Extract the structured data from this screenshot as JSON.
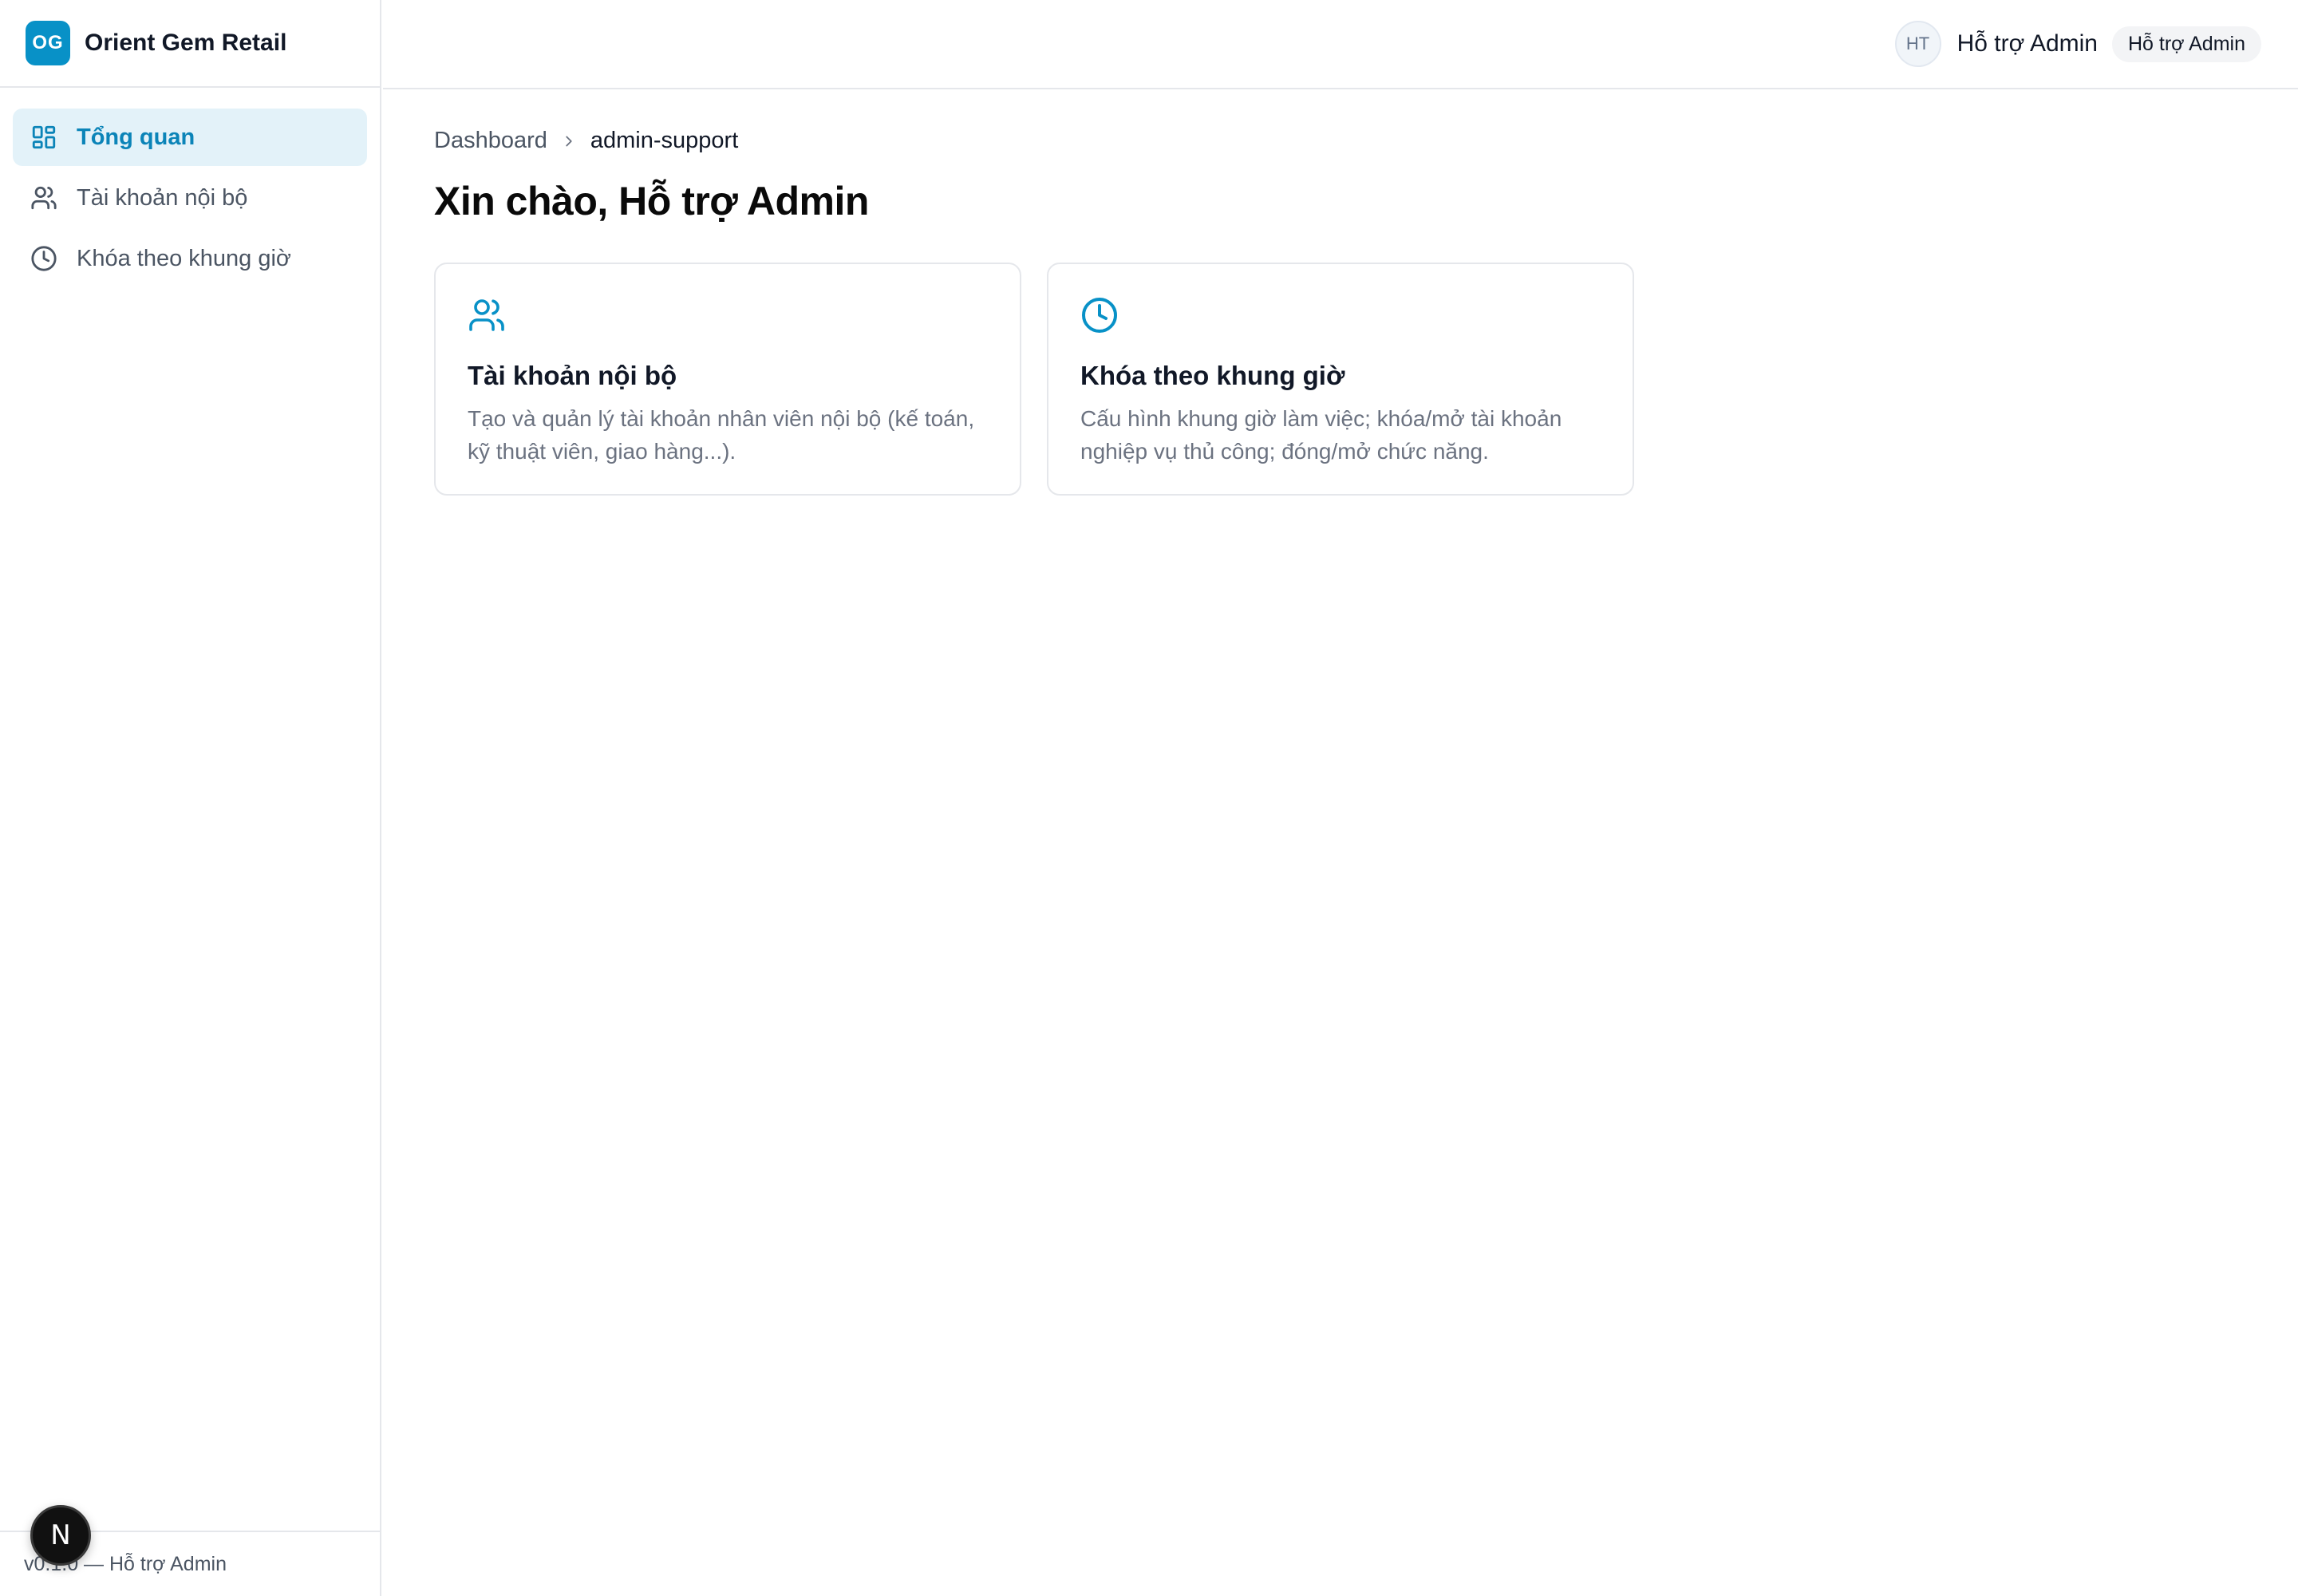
{
  "brand": {
    "logo_text": "OG",
    "name": "Orient Gem Retail"
  },
  "sidebar": {
    "items": [
      {
        "label": "Tổng quan",
        "icon": "dashboard-grid-icon",
        "active": true
      },
      {
        "label": "Tài khoản nội bộ",
        "icon": "users-icon",
        "active": false
      },
      {
        "label": "Khóa theo khung giờ",
        "icon": "clock-icon",
        "active": false
      }
    ],
    "footer": "v0.1.0 — Hỗ trợ Admin",
    "next_badge": "N"
  },
  "topbar": {
    "avatar_initials": "HT",
    "user_name": "Hỗ trợ Admin",
    "role_badge": "Hỗ trợ Admin"
  },
  "breadcrumb": {
    "root": "Dashboard",
    "current": "admin-support"
  },
  "page_title": "Xin chào, Hỗ trợ Admin",
  "cards": [
    {
      "icon": "users-icon",
      "title": "Tài khoản nội bộ",
      "description": "Tạo và quản lý tài khoản nhân viên nội bộ (kế toán, kỹ thuật viên, giao hàng...)."
    },
    {
      "icon": "clock-icon",
      "title": "Khóa theo khung giờ",
      "description": "Cấu hình khung giờ làm việc; khóa/mở tài khoản nghiệp vụ thủ công; đóng/mở chức năng."
    }
  ],
  "colors": {
    "accent": "#0891c7",
    "active_bg": "#e3f2f9"
  }
}
